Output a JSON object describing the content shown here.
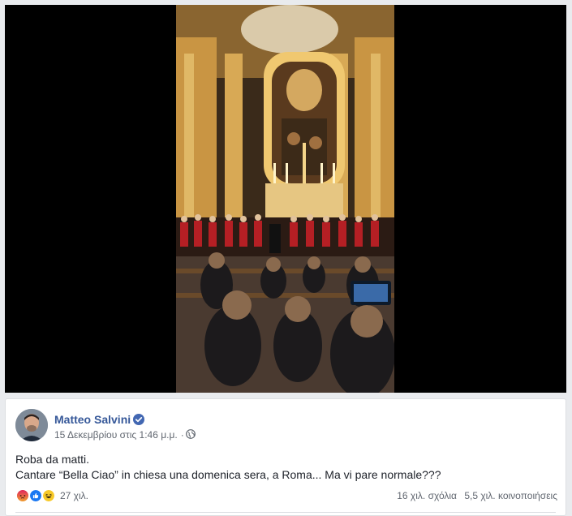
{
  "post": {
    "author": "Matteo Salvini",
    "timestamp": "15 Δεκεμβρίου στις 1:46 μ.μ.",
    "separator": "·",
    "text_line1": "Roba da matti.",
    "text_line2": "Cantare “Bella Ciao” in chiesa una domenica sera, a Roma... Ma vi pare normale???"
  },
  "reactions": {
    "icons": [
      "angry-icon",
      "like-icon",
      "haha-icon"
    ],
    "count": "27 χιλ.",
    "comments": "16 χιλ. σχόλια",
    "shares": "5,5 χιλ. κοινοποιήσεις"
  },
  "colors": {
    "author_link": "#365899",
    "verified_badge": "#4267b2",
    "background": "#e9ebee",
    "card_border": "#dddfe2"
  }
}
